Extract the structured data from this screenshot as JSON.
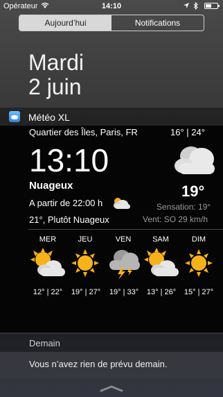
{
  "status": {
    "carrier": "Opérateur",
    "time": "14:10",
    "wifi_icon": "wifi-icon",
    "location_icon": "location-arrow-icon",
    "bluetooth_icon": "bluetooth-icon",
    "battery_icon": "battery-icon"
  },
  "tabs": {
    "today": "Aujourd’hui",
    "notifications": "Notifications"
  },
  "date": {
    "day": "Mardi",
    "date": "2 juin"
  },
  "widget": {
    "app_name": "Météo XL",
    "location": "Quartier des Îles, Paris, FR",
    "minmax": "16°   |   24°",
    "time": "13:10",
    "condition": "Nuageux",
    "temp": "19°",
    "feel": "Sensation: 19°",
    "wind": "Vent: SO 29 km/h",
    "from": "A partir de 22:00 h",
    "from_value": "21°, Plutôt Nuageux",
    "forecast": [
      {
        "day": "MER",
        "temps": "12° | 22°",
        "icon": "sun-cloud-icon"
      },
      {
        "day": "JEU",
        "temps": "19° | 27°",
        "icon": "sun-icon"
      },
      {
        "day": "VEN",
        "temps": "19° | 33°",
        "icon": "thunderstorm-icon"
      },
      {
        "day": "SAM",
        "temps": "13° | 26°",
        "icon": "sun-cloud-icon"
      },
      {
        "day": "DIM",
        "temps": "15° | 27°",
        "icon": "sun-icon"
      }
    ]
  },
  "demain": {
    "title": "Demain",
    "text": "Vous n’avez rien de prévu demain."
  },
  "colors": {
    "sun": "#f7b21b",
    "cloud": "#e6e6e6",
    "widget_bg": "#050505"
  }
}
